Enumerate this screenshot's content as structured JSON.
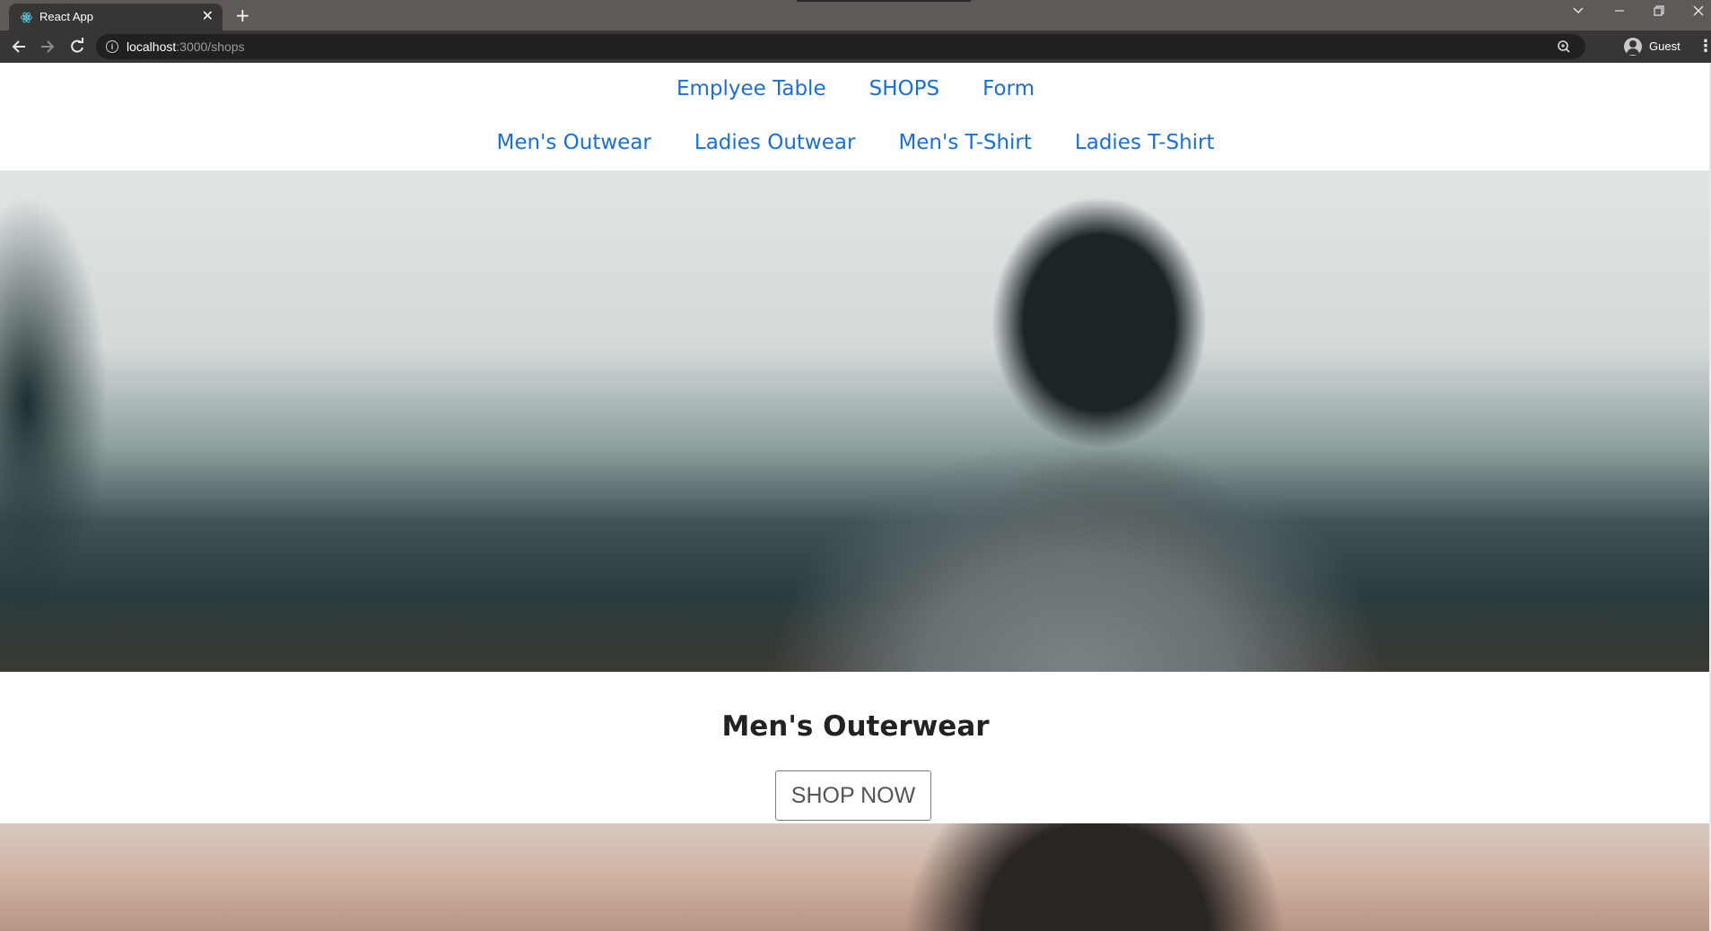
{
  "browser": {
    "tab_title": "React App",
    "tab_close": "✕",
    "new_tab": "+",
    "url_host": "localhost",
    "url_path": ":3000/shops",
    "profile_name": "Guest",
    "icons": [
      "react-icon",
      "back-icon",
      "forward-icon",
      "reload-icon",
      "info-icon",
      "zoom-icon",
      "profile-icon",
      "menu-icon",
      "tab-search-icon",
      "minimize-icon",
      "restore-icon",
      "close-window-icon"
    ]
  },
  "nav": {
    "row1": [
      "Emplyee Table",
      "SHOPS",
      "Form"
    ],
    "row2": [
      "Men's Outwear",
      "Ladies Outwear",
      "Men's T-Shirt",
      "Ladies T-Shirt"
    ]
  },
  "section": {
    "title": "Men's Outerwear",
    "button": "SHOP NOW"
  },
  "colors": {
    "link": "#1a6fd6",
    "tabbar": "#5f5a57",
    "toolbar": "#383634"
  }
}
